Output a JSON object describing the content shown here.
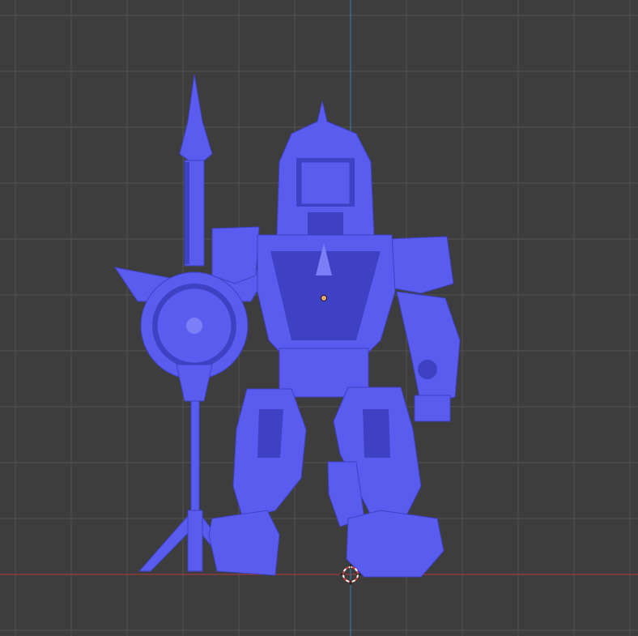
{
  "viewport": {
    "view": "front-orthographic",
    "colors": {
      "background": "#3d3d3d",
      "grid_minor": "#474747",
      "grid_major": "#525252",
      "axis_x": "#b23a3a",
      "axis_z": "#3a7fb2",
      "model": "#5a5cf0",
      "model_shadow": "#3f41c4",
      "model_highlight": "#7c7ef8",
      "origin_dot": "#f0a070",
      "cursor_ring_white": "#ffffff",
      "cursor_ring_red": "#d04040"
    },
    "objects": [
      {
        "name": "megazord-mesh",
        "selected": false
      },
      {
        "name": "3d-cursor",
        "selected": false
      }
    ]
  }
}
